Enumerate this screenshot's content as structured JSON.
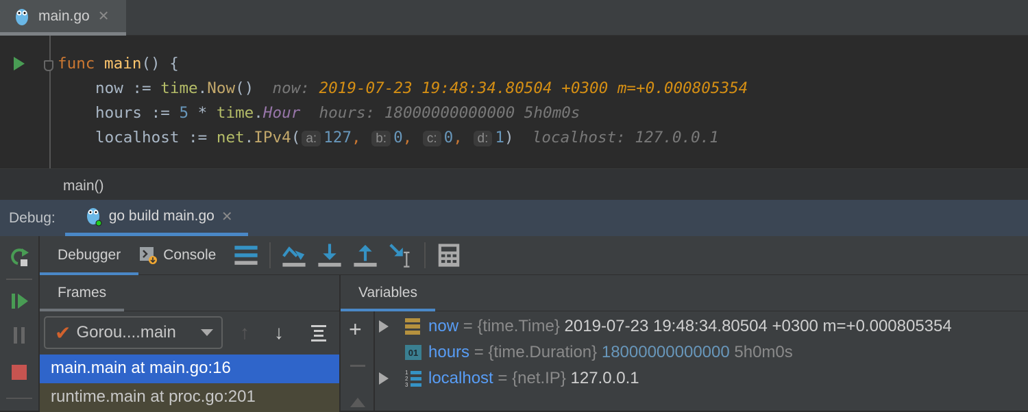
{
  "editor_tab": {
    "label": "main.go"
  },
  "code": {
    "line1": {
      "kw": "func",
      "name": "main",
      "rest": "() {"
    },
    "line2": {
      "var": "now",
      "op": " := ",
      "pkg": "time",
      "dot": ".",
      "call": "Now",
      "rest": "()",
      "hint_label": "now:",
      "hint_value": "2019-07-23 19:48:34.80504 +0300 m=+0.000805354"
    },
    "line3": {
      "var": "hours",
      "op": " := ",
      "num": "5",
      "mul": " * ",
      "pkg": "time",
      "dot": ".",
      "const": "Hour",
      "hint": "hours: 18000000000000 5h0m0s"
    },
    "line4": {
      "var": "localhost",
      "op": " := ",
      "pkg": "net",
      "dot": ".",
      "call": "IPv4",
      "open": "(",
      "params": [
        {
          "name": "a:",
          "value": "127"
        },
        {
          "name": "b:",
          "value": "0"
        },
        {
          "name": "c:",
          "value": "0"
        },
        {
          "name": "d:",
          "value": "1"
        }
      ],
      "close": ")",
      "hint": "localhost: 127.0.0.1"
    }
  },
  "breadcrumb": "main()",
  "debug": {
    "label": "Debug:",
    "tab": "go build main.go"
  },
  "toolbar": {
    "debugger": "Debugger",
    "console": "Console"
  },
  "frames": {
    "header": "Frames",
    "goroutine": "Gorou....main",
    "items": [
      "main.main at main.go:16",
      "runtime.main at proc.go:201"
    ]
  },
  "variables": {
    "header": "Variables",
    "items": [
      {
        "name": "now",
        "eq": " = ",
        "type": "{time.Time}",
        "value": "2019-07-23 19:48:34.80504 +0300 m=+0.000805354"
      },
      {
        "name": "hours",
        "eq": " = ",
        "type": "{time.Duration}",
        "value": "18000000000000",
        "extra": "5h0m0s"
      },
      {
        "name": "localhost",
        "eq": " = ",
        "type": "{net.IP}",
        "value": "127.0.0.1"
      }
    ]
  },
  "colors": {
    "accent": "#4a88c7",
    "selection": "#2f65ca"
  }
}
